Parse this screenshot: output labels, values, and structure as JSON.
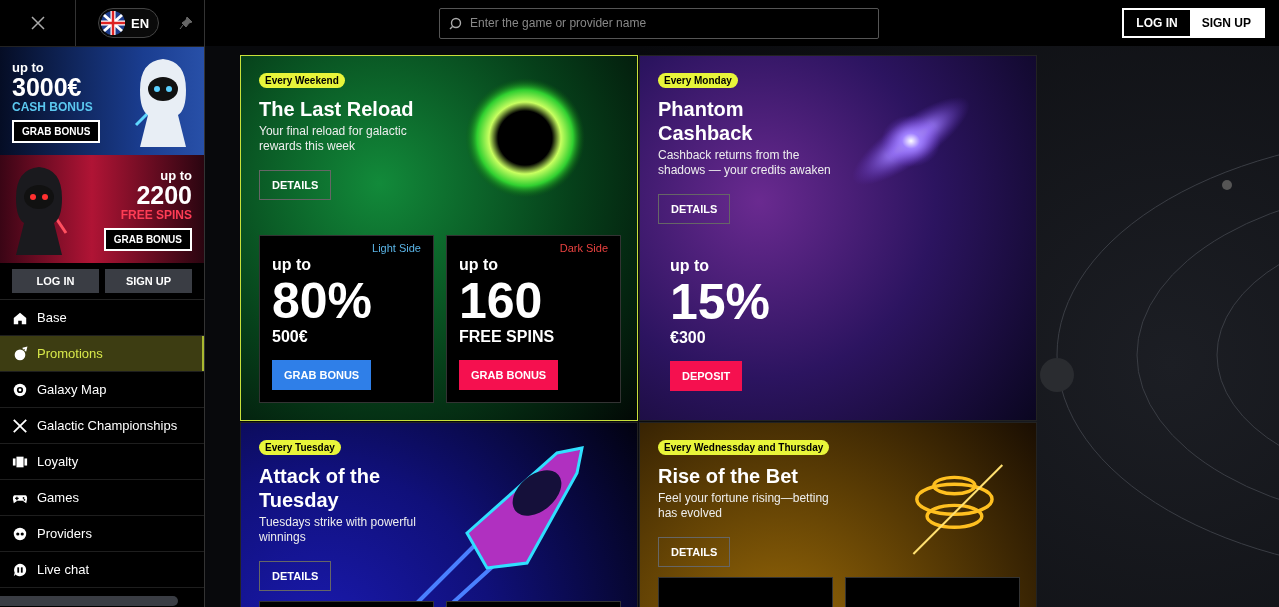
{
  "sidebar": {
    "language": "EN",
    "banners": [
      {
        "kind": "light",
        "lead": "up to",
        "amount": "3000€",
        "bonus": "CASH BONUS",
        "button": "GRAB BONUS"
      },
      {
        "kind": "dark",
        "lead": "up to",
        "amount": "2200",
        "bonus": "FREE SPINS",
        "button": "GRAB BONUS"
      }
    ],
    "auth_buttons": [
      "LOG IN",
      "SIGN UP"
    ],
    "items": [
      {
        "label": "Base",
        "selected": false
      },
      {
        "label": "Promotions",
        "selected": true
      },
      {
        "label": "Galaxy Map",
        "selected": false
      },
      {
        "label": "Galactic Championships",
        "selected": false
      },
      {
        "label": "Loyalty",
        "selected": false
      },
      {
        "label": "Games",
        "selected": false
      },
      {
        "label": "Providers",
        "selected": false
      },
      {
        "label": "Live chat",
        "selected": false
      }
    ]
  },
  "header": {
    "search": {
      "placeholder": "Enter the game or provider name"
    },
    "login": "LOG IN",
    "signup": "SIGN UP"
  },
  "cards": [
    {
      "kind": "split",
      "highlighted": true,
      "badge": "Every Weekend",
      "title": "The Last Reload",
      "description": "Your final reload for galactic rewards this week",
      "details": "DETAILS",
      "offers": [
        {
          "side": "Light Side",
          "color": "#5ab4e6",
          "lead": "up to",
          "value": "80%",
          "sub": "500€",
          "button": {
            "label": "GRAB BONUS",
            "color": "#2f7fe8"
          }
        },
        {
          "side": "Dark Side",
          "color": "#e8413f",
          "lead": "up to",
          "value": "160",
          "sub": "FREE SPINS",
          "button": {
            "label": "GRAB BONUS",
            "color": "#f5104f"
          }
        }
      ]
    },
    {
      "kind": "single",
      "highlighted": false,
      "badge": "Every Monday",
      "title": "Phantom Cashback",
      "description": "Cashback returns from the shadows — your credits awaken",
      "details": "DETAILS",
      "offers": [
        {
          "lead": "up to",
          "value": "15%",
          "sub": "€300",
          "button": {
            "label": "DEPOSIT",
            "color": "#f5104f"
          }
        }
      ]
    },
    {
      "kind": "split",
      "highlighted": false,
      "badge": "Every Tuesday",
      "title": "Attack of the Tuesday",
      "description": "Tuesdays strike with powerful winnings",
      "details": "DETAILS"
    },
    {
      "kind": "split",
      "highlighted": false,
      "badge": "Every Wednessday and Thursday",
      "title": "Rise of the Bet",
      "description": "Feel your fortune rising—betting has evolved",
      "details": "DETAILS"
    }
  ]
}
